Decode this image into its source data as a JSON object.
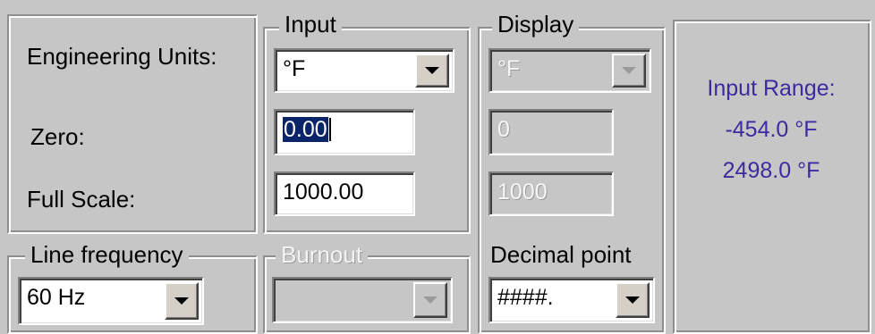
{
  "engineering_units": {
    "label": "Engineering Units:",
    "zero_label": "Zero:",
    "full_scale_label": "Full Scale:"
  },
  "input": {
    "title": "Input",
    "units_value": "°F",
    "zero_value": "0.00",
    "full_scale_value": "1000.00"
  },
  "display": {
    "title": "Display",
    "units_value": "°F",
    "zero_value": "0",
    "full_scale_value": "1000",
    "decimal_point_label": "Decimal point",
    "decimal_point_value": "####."
  },
  "input_range": {
    "label": "Input Range:",
    "min": "-454.0 °F",
    "max": "2498.0 °F"
  },
  "line_frequency": {
    "title": "Line frequency",
    "value": "60 Hz"
  },
  "burnout": {
    "title": "Burnout",
    "value": ""
  },
  "colors": {
    "panel_bg": "#c6c6c6",
    "range_text": "#3c2aa0",
    "selection": "#0a246a"
  }
}
